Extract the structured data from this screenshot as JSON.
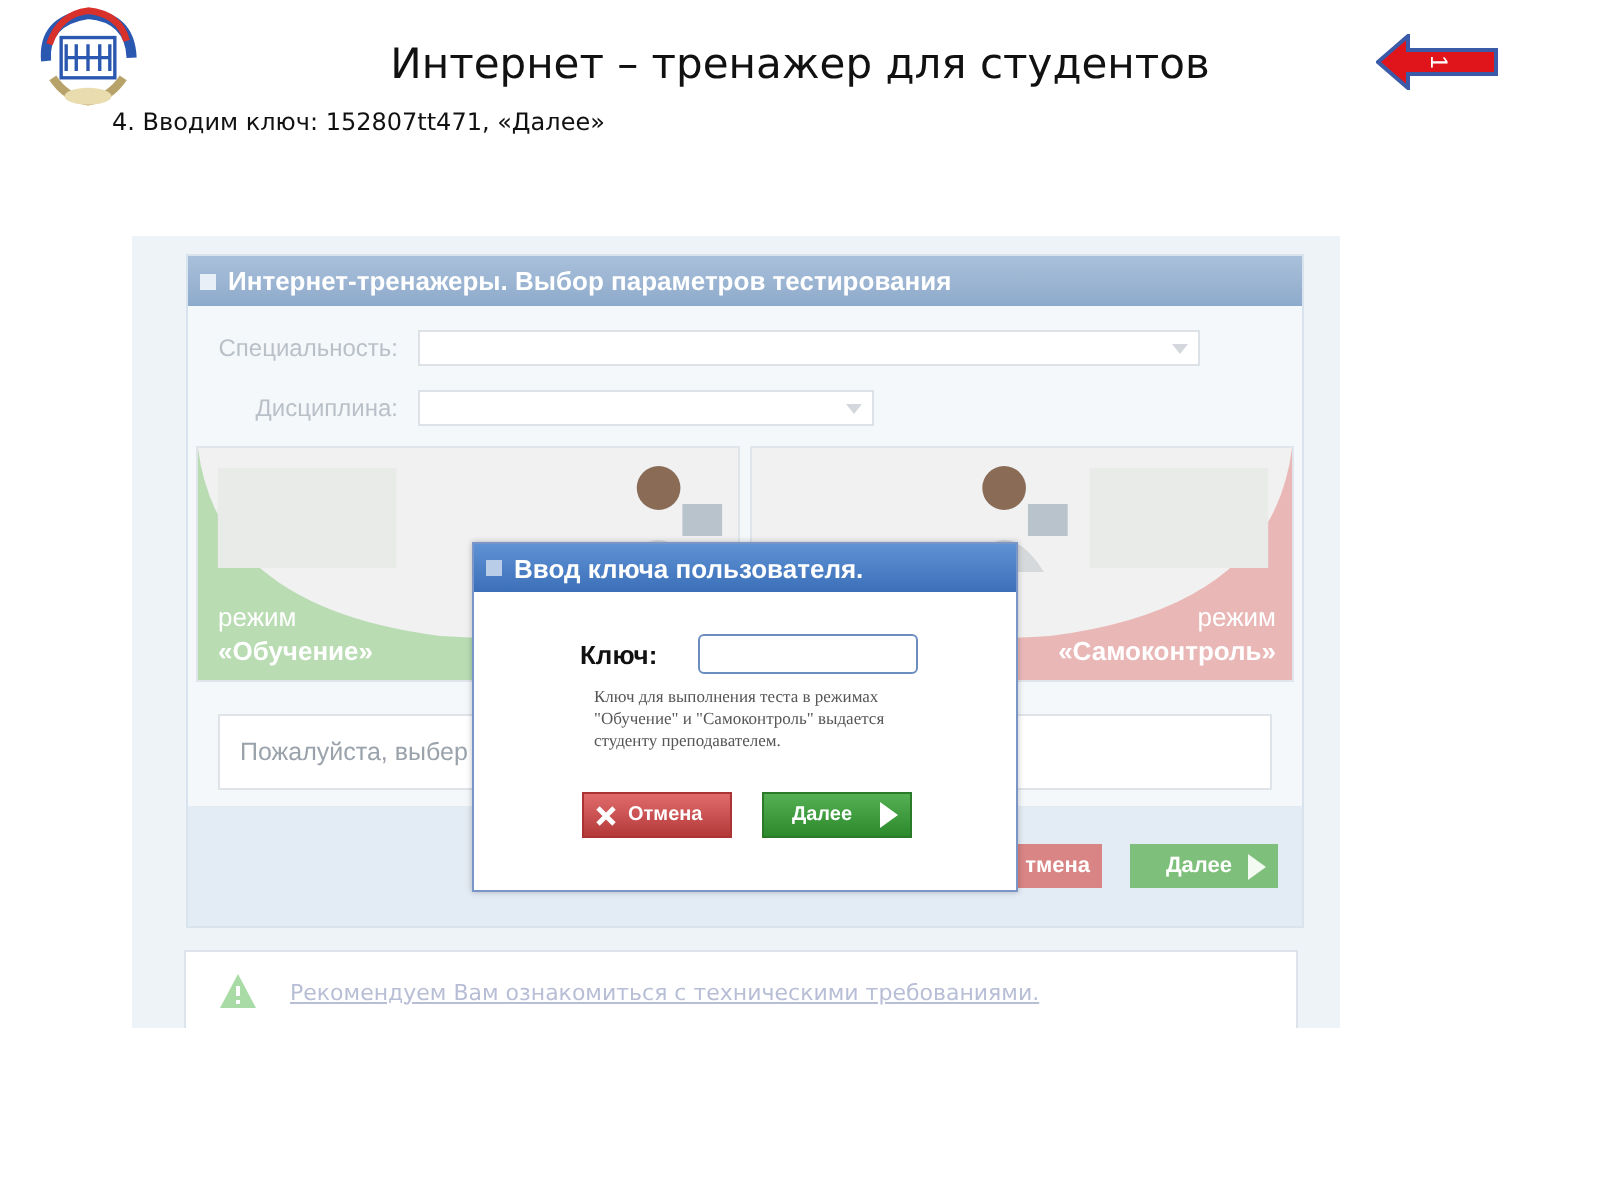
{
  "slide": {
    "title": "Интернет – тренажер для студентов",
    "step": "4. Вводим ключ: 152807tt471, «Далее»",
    "back_button": "1"
  },
  "app": {
    "panel_title": "Интернет-тренажеры. Выбор параметров тестирования",
    "fields": [
      {
        "label": "Специальность:",
        "kind": "wide"
      },
      {
        "label": "Дисциплина:",
        "kind": "narrow"
      }
    ],
    "modes": [
      {
        "line1": "режим",
        "line2": "«Обучение»",
        "color": "#b9dcb3"
      },
      {
        "line1": "режим",
        "line2": "«Самоконтроль»",
        "color": "#eab7b7"
      }
    ],
    "prompt": "Пожалуйста, выбер",
    "buttons": [
      {
        "label": "тмена",
        "kind": "cancel"
      },
      {
        "label": "Далее",
        "kind": "next"
      }
    ],
    "notice": "Рекомендуем Вам ознакомиться с техническими требованиями."
  },
  "dialog": {
    "title": "Ввод ключа пользователя.",
    "key_label": "Ключ:",
    "hint": "Ключ для выполнения теста в режимах \"Обучение\" и \"Самоконтроль\" выдается студенту преподавателем.",
    "buttons": [
      {
        "label": "Отмена",
        "kind": "cancel"
      },
      {
        "label": "Далее",
        "kind": "next"
      }
    ]
  }
}
